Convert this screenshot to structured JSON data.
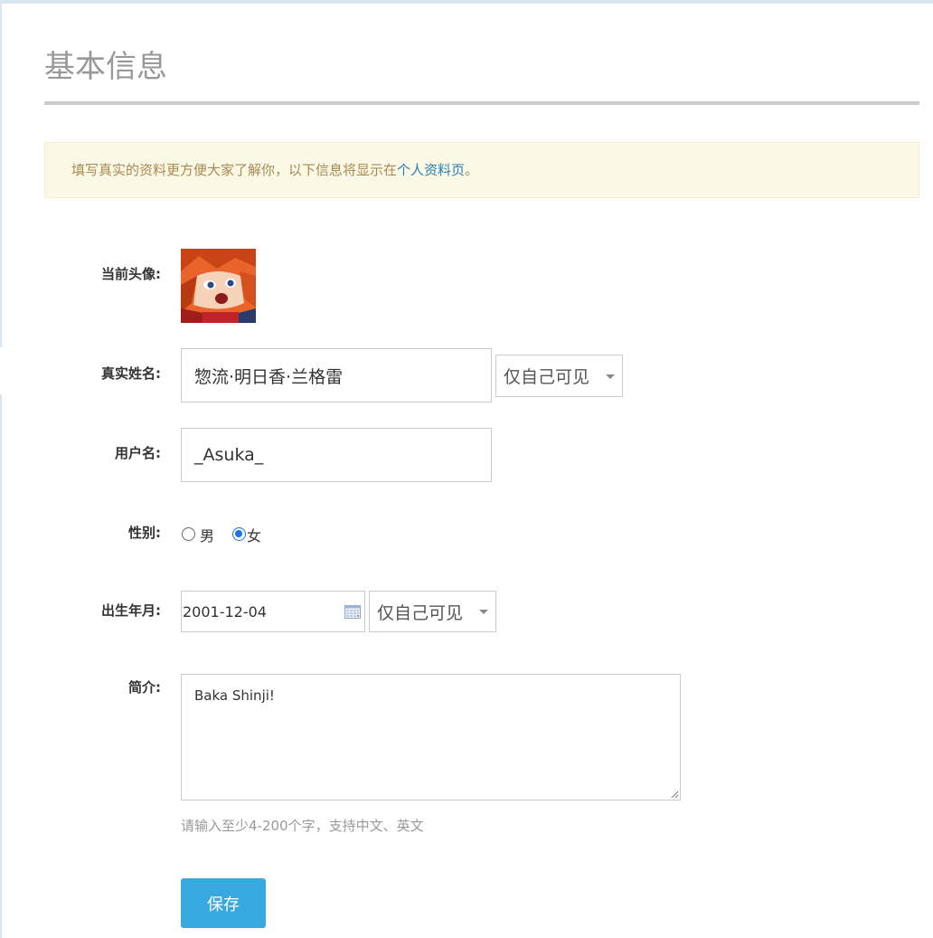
{
  "page": {
    "title": "基本信息"
  },
  "notice": {
    "text": "填写真实的资料更方便大家了解你，以下信息将显示在",
    "link_text": "个人资料页",
    "suffix": "。"
  },
  "form": {
    "avatar_label": "当前头像:",
    "realname_label": "真实姓名:",
    "realname_value": "惣流·明日香·兰格雷",
    "realname_privacy": "仅自己可见",
    "username_label": "用户名:",
    "username_value": "_Asuka_",
    "gender_label": "性别:",
    "gender_options": [
      "男",
      "女"
    ],
    "gender_selected": "女",
    "birth_label": "出生年月:",
    "birth_value": "2001-12-04",
    "birth_privacy": "仅自己可见",
    "bio_label": "简介:",
    "bio_value": "Baka Shinji!",
    "bio_hint": "请输入至少4-200个字，支持中文、英文",
    "save_label": "保存"
  },
  "colors": {
    "accent": "#38a9e0",
    "notice_bg": "#fcf8e6",
    "notice_text": "#a88a52",
    "link": "#2a7fb3"
  },
  "icons": {
    "date_picker": "calendar-icon",
    "select_caret": "caret-down-icon"
  }
}
